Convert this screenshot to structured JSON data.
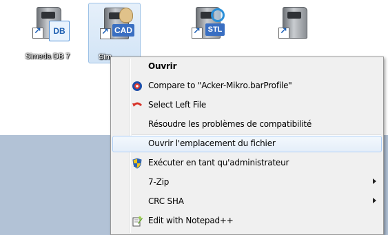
{
  "desktop": {
    "icons": [
      {
        "label": "Simeda DB 7",
        "badge": "DB",
        "selected": false
      },
      {
        "label": "Sim",
        "badge": "CAD",
        "selected": true
      },
      {
        "label": "",
        "badge": "STL",
        "selected": false
      },
      {
        "label": "",
        "badge": "",
        "selected": false
      }
    ]
  },
  "context_menu": {
    "items": [
      {
        "label": "Ouvrir",
        "bold": true,
        "icon": "none"
      },
      {
        "label": "Compare to \"Acker-Mikro.barProfile\"",
        "icon": "compare-icon"
      },
      {
        "label": "Select Left File",
        "icon": "undo-arrow-icon"
      },
      {
        "label": "Résoudre les problèmes de compatibilité",
        "icon": "none"
      },
      {
        "label": "Ouvrir l'emplacement du fichier",
        "icon": "none",
        "hovered": true
      },
      {
        "label": "Exécuter en tant qu'administrateur",
        "icon": "shield-icon"
      },
      {
        "label": "7-Zip",
        "icon": "none",
        "submenu": true
      },
      {
        "label": "CRC SHA",
        "icon": "none",
        "submenu": true
      },
      {
        "label": "Edit with Notepad++",
        "icon": "notepad-icon"
      }
    ]
  },
  "colors": {
    "menu_bg": "#f0f0f0",
    "hover_border": "#aecff7",
    "desktop_lower": "#b2c2d6"
  }
}
